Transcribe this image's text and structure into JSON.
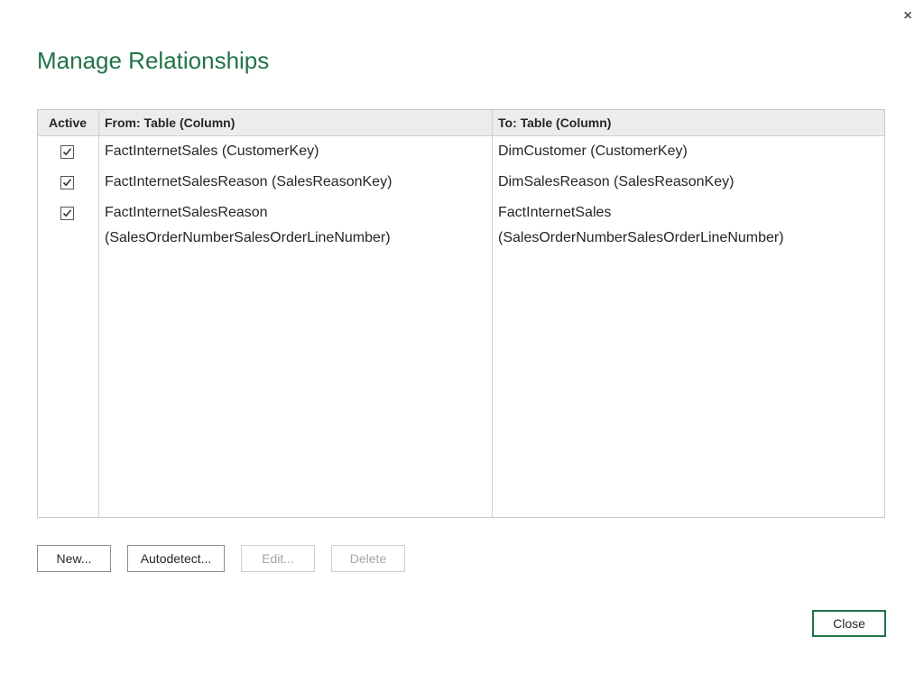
{
  "dialog": {
    "title": "Manage Relationships",
    "close_glyph": "×"
  },
  "table": {
    "headers": {
      "active": "Active",
      "from": "From: Table (Column)",
      "to": "To: Table (Column)"
    },
    "rows": [
      {
        "active": true,
        "from_line1": "FactInternetSales (CustomerKey)",
        "from_line2": "",
        "to_line1": "DimCustomer (CustomerKey)",
        "to_line2": ""
      },
      {
        "active": true,
        "from_line1": "FactInternetSalesReason (SalesReasonKey)",
        "from_line2": "",
        "to_line1": "DimSalesReason (SalesReasonKey)",
        "to_line2": ""
      },
      {
        "active": true,
        "from_line1": "FactInternetSalesReason",
        "from_line2": "(SalesOrderNumberSalesOrderLineNumber)",
        "to_line1": "FactInternetSales",
        "to_line2": "(SalesOrderNumberSalesOrderLineNumber)"
      }
    ]
  },
  "buttons": {
    "new": "New...",
    "autodetect": "Autodetect...",
    "edit": "Edit...",
    "delete": "Delete",
    "close": "Close"
  },
  "colors": {
    "accent": "#217346",
    "header_bg": "#ececec",
    "border": "#c8c8c8"
  },
  "icons": {
    "close": "close-icon",
    "checkbox": "checkbox-checked-icon"
  }
}
